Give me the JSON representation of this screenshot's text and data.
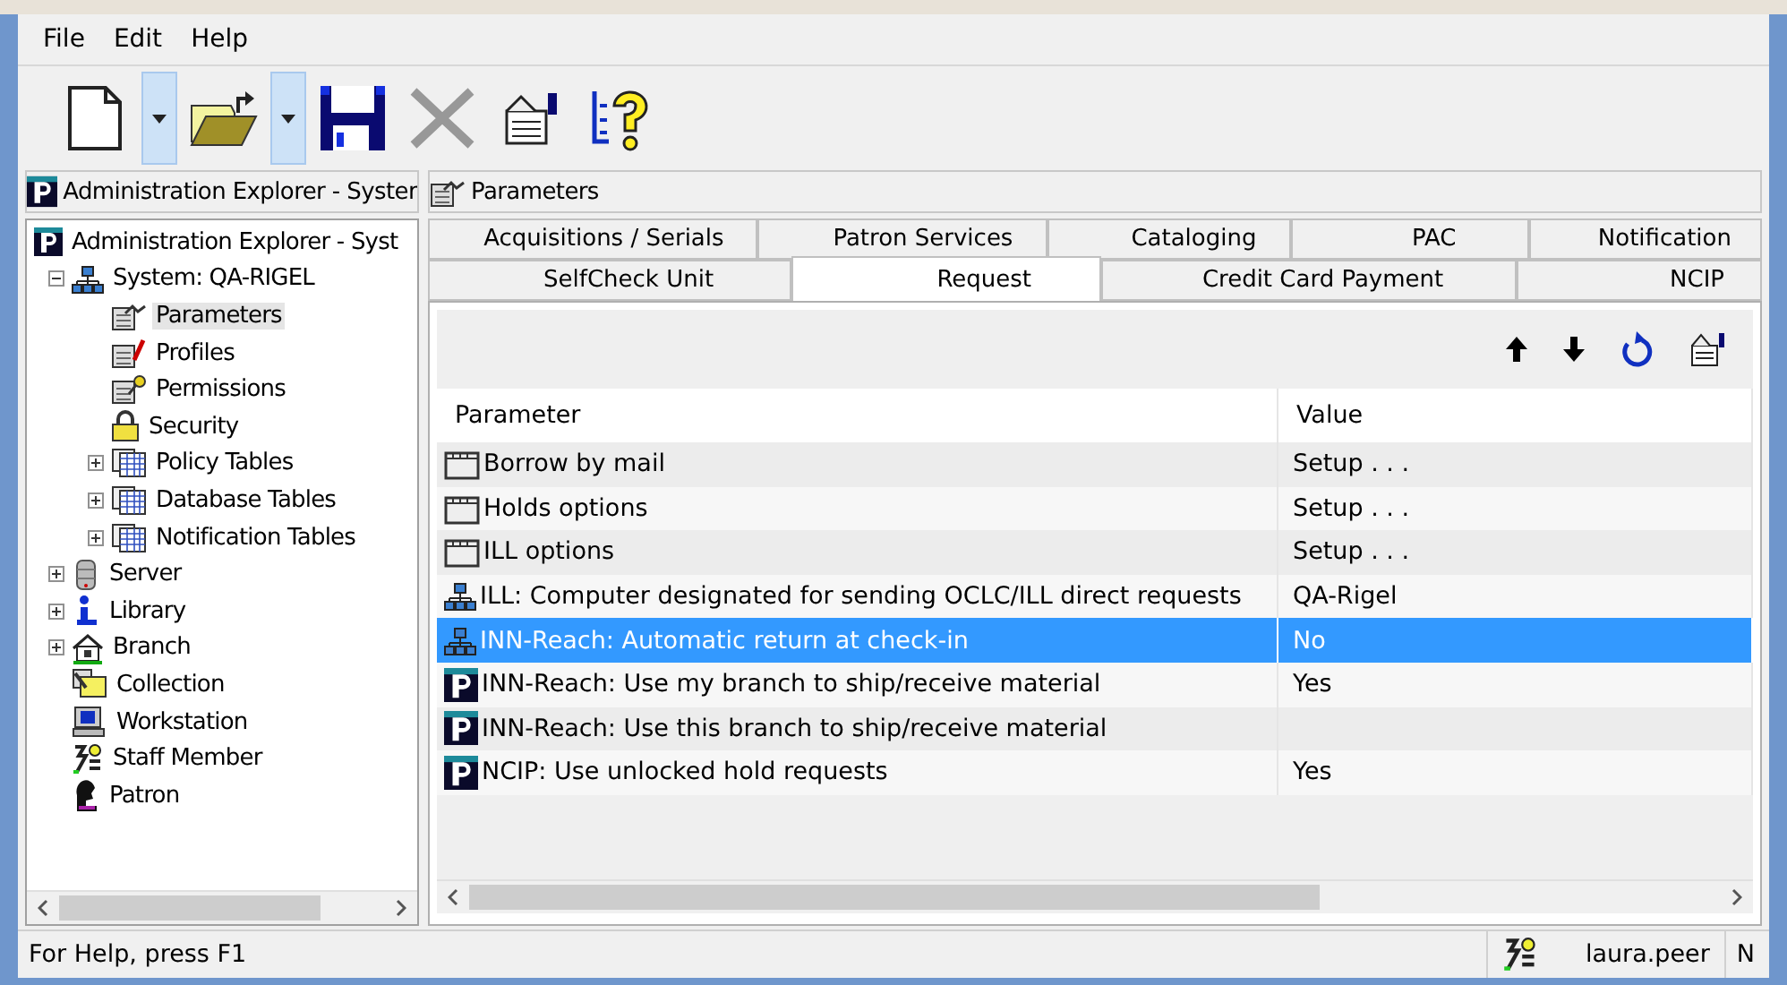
{
  "menu": [
    "File",
    "Edit",
    "Help"
  ],
  "toolbar": [
    {
      "kind": "new",
      "disabled": false
    },
    {
      "kind": "dropdown",
      "disabled": false
    },
    {
      "kind": "open",
      "disabled": false
    },
    {
      "kind": "dropdown",
      "disabled": false
    },
    {
      "kind": "save",
      "disabled": false
    },
    {
      "kind": "delete",
      "disabled": true
    },
    {
      "kind": "properties",
      "disabled": false
    },
    {
      "kind": "help",
      "disabled": false
    }
  ],
  "left_header": {
    "title": "Administration Explorer - Syster"
  },
  "right_header": {
    "title": "Parameters"
  },
  "tree": [
    {
      "label": "Administration Explorer - Syst",
      "selected": false,
      "children": [
        {
          "label": "System: QA-RIGEL",
          "selected": false,
          "expanded": true,
          "children": [
            {
              "label": "Parameters",
              "selected": true
            },
            {
              "label": "Profiles",
              "selected": false
            },
            {
              "label": "Permissions",
              "selected": false
            },
            {
              "label": "Security",
              "selected": false
            },
            {
              "label": "Policy Tables",
              "selected": false,
              "expanded": false
            },
            {
              "label": "Database Tables",
              "selected": false,
              "expanded": false
            },
            {
              "label": "Notification Tables",
              "selected": false,
              "expanded": false
            }
          ]
        },
        {
          "label": "Server",
          "selected": false,
          "expanded": false
        },
        {
          "label": "Library",
          "selected": false,
          "expanded": false
        },
        {
          "label": "Branch",
          "selected": false,
          "expanded": false
        },
        {
          "label": "Collection",
          "selected": false
        },
        {
          "label": "Workstation",
          "selected": false
        },
        {
          "label": "Staff Member",
          "selected": false
        },
        {
          "label": "Patron",
          "selected": false
        }
      ]
    }
  ],
  "tab_rows": [
    [
      {
        "label": "Acquisitions / Serials",
        "selected": false
      },
      {
        "label": "Patron Services",
        "selected": false
      },
      {
        "label": "Cataloging",
        "selected": false
      },
      {
        "label": "PAC",
        "selected": false
      },
      {
        "label": "Notification",
        "selected": false
      }
    ],
    [
      {
        "label": "SelfCheck Unit",
        "selected": false
      },
      {
        "label": "Request",
        "selected": true
      },
      {
        "label": "Credit Card Payment",
        "selected": false
      },
      {
        "label": "NCIP",
        "selected": false
      }
    ]
  ],
  "table": {
    "columns": [
      "Parameter",
      "Value"
    ],
    "rows": [
      {
        "kind": "setup",
        "parameter": "Borrow by mail",
        "value": "Setup . . .",
        "selected": false
      },
      {
        "kind": "setup",
        "parameter": "Holds options",
        "value": "Setup . . .",
        "selected": false
      },
      {
        "kind": "setup",
        "parameter": "ILL options",
        "value": "Setup . . .",
        "selected": false
      },
      {
        "kind": "system",
        "parameter": "ILL: Computer designated for sending OCLC/ILL direct requests",
        "value": "QA-Rigel",
        "selected": false
      },
      {
        "kind": "system",
        "parameter": "INN-Reach: Automatic return at check-in",
        "value": "No",
        "selected": true
      },
      {
        "kind": "branch",
        "parameter": "INN-Reach: Use my branch to ship/receive material",
        "value": "Yes",
        "selected": false
      },
      {
        "kind": "branch",
        "parameter": "INN-Reach: Use this branch to ship/receive material",
        "selected": false
      },
      {
        "kind": "branch",
        "parameter": "NCIP: Use unlocked hold requests",
        "value": "Yes",
        "selected": false
      }
    ]
  },
  "status_bar": {
    "help": "For Help, press F1",
    "user": "laura.peer",
    "panel_3": "N"
  }
}
